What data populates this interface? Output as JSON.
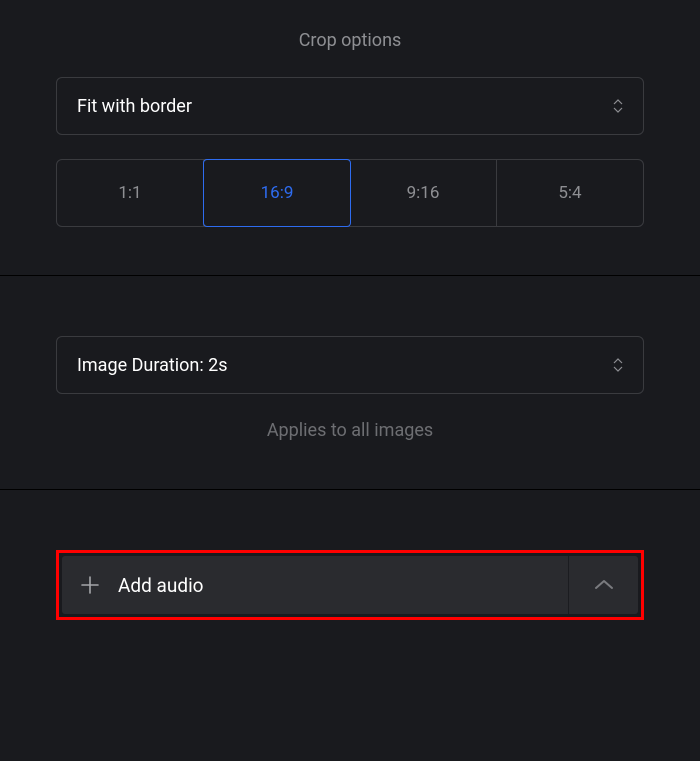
{
  "crop": {
    "title": "Crop options",
    "fit_mode": "Fit with border",
    "aspects": [
      {
        "label": "1:1",
        "active": false
      },
      {
        "label": "16:9",
        "active": true
      },
      {
        "label": "9:16",
        "active": false
      },
      {
        "label": "5:4",
        "active": false
      }
    ]
  },
  "duration": {
    "label": "Image Duration: 2s",
    "hint": "Applies to all images"
  },
  "audio": {
    "add_label": "Add audio"
  }
}
